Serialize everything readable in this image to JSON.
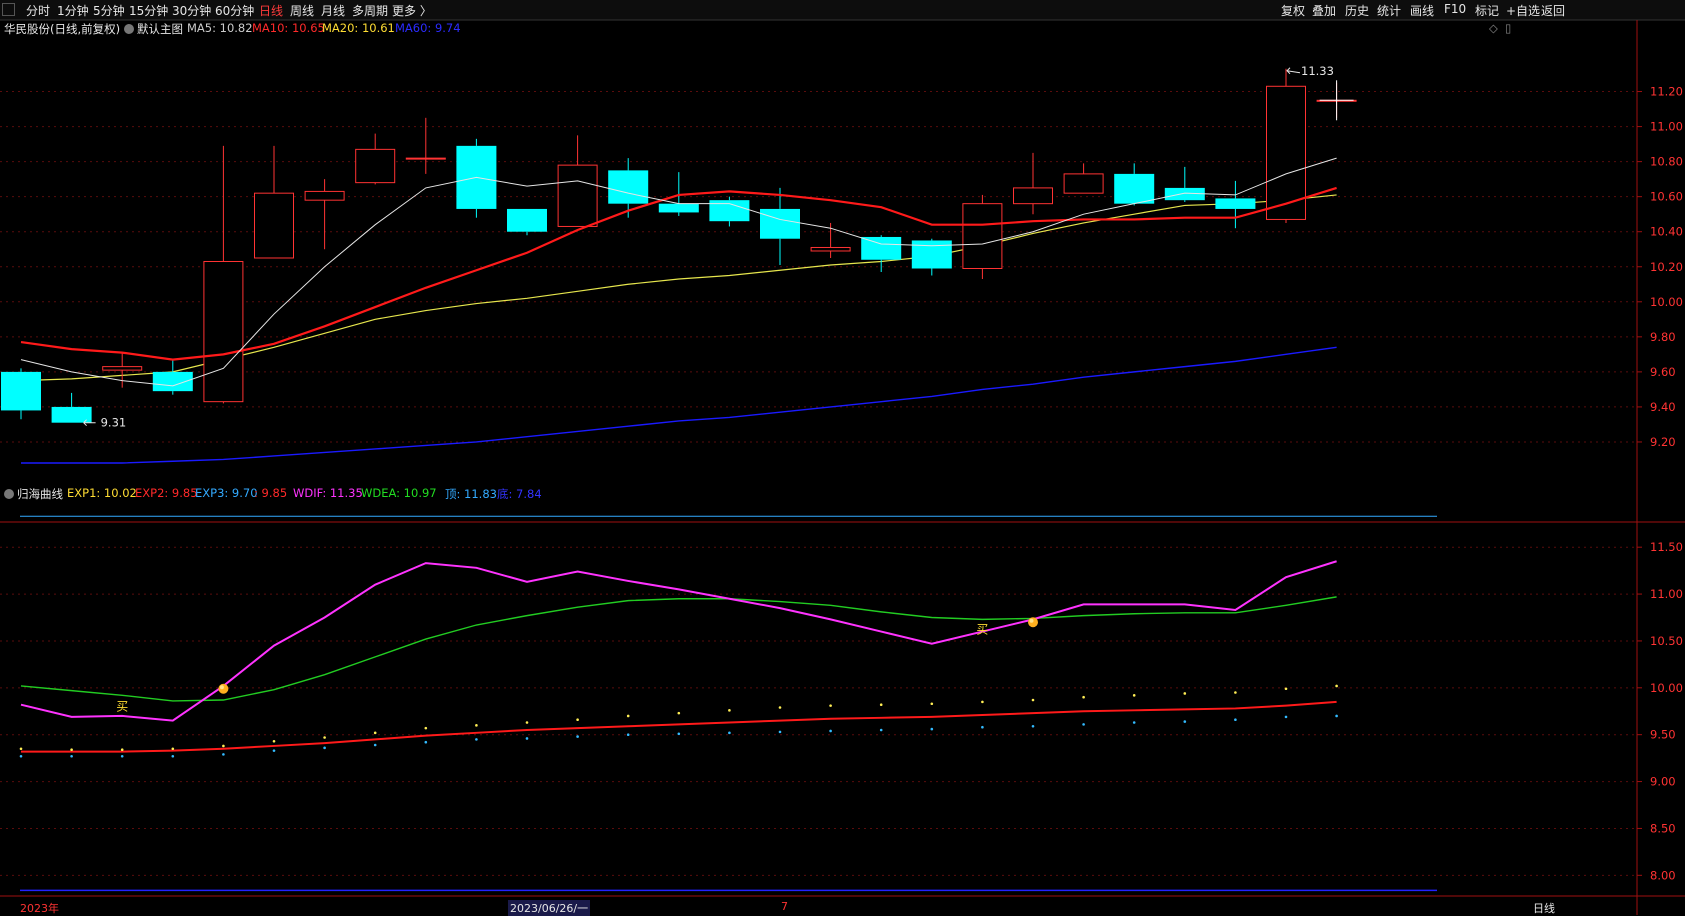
{
  "topbar": {
    "left_items": [
      "分时",
      "1分钟",
      "5分钟",
      "15分钟",
      "30分钟",
      "60分钟",
      "日线",
      "周线",
      "月线",
      "多周期",
      "更多 〉"
    ],
    "active_item": "日线",
    "right_items": [
      "复权",
      "叠加",
      "历史",
      "统计",
      "画线",
      "F10",
      "标记",
      "+自选",
      "返回"
    ]
  },
  "main_panel": {
    "stock_title": "华民股份(日线,前复权)",
    "template_name": "默认主图",
    "ma": [
      {
        "label": "MA5: 10.82",
        "color": "#e6e6e6"
      },
      {
        "label": "MA10: 10.65",
        "color": "#ff2a2a"
      },
      {
        "label": "MA20: 10.61",
        "color": "#ffdd33"
      },
      {
        "label": "MA60: 9.74",
        "color": "#2b2bff"
      }
    ],
    "yaxis": [
      "11.20",
      "11.00",
      "10.80",
      "10.60",
      "10.40",
      "10.20",
      "10.00",
      "9.80",
      "9.60",
      "9.40",
      "9.20"
    ],
    "high_mark": "11.33",
    "low_mark": "9.31"
  },
  "sub_panel": {
    "indicator_name": "归海曲线",
    "values": [
      {
        "label": "EXP1: 10.02",
        "color": "#ffdd33"
      },
      {
        "label": "EXP2: 9.85",
        "color": "#ff2a2a"
      },
      {
        "label": "EXP3: 9.70",
        "color": "#33aaff"
      },
      {
        "label": ": 9.85",
        "color": "#ff2a2a"
      },
      {
        "label": "WDIF: 11.35",
        "color": "#ff33ff"
      },
      {
        "label": "WDEA: 10.97",
        "color": "#22dd22"
      },
      {
        "label": "顶: 11.83",
        "color": "#33aaff"
      },
      {
        "label": "底: 7.84",
        "color": "#3333ff"
      }
    ],
    "yaxis": [
      "11.50",
      "11.00",
      "10.50",
      "10.00",
      "9.50",
      "9.00",
      "8.50",
      "8.00"
    ],
    "buy_label": "买"
  },
  "bottom": {
    "year": "2023年",
    "date_cursor": "2023/06/26/一",
    "month": "7",
    "period": "日线"
  },
  "colors": {
    "up": "#ff3333",
    "down": "#00ffff",
    "ma5": "#e6e6e6",
    "ma10": "#ff1a1a",
    "ma20": "#e6e64d",
    "ma60": "#1a1aff",
    "wdif": "#ff33ff",
    "wdea": "#22cc22",
    "axis": "#a01010"
  },
  "chart_data": {
    "type": "candlestick",
    "candles": [
      {
        "o": 9.6,
        "c": 9.38,
        "h": 9.62,
        "l": 9.33
      },
      {
        "o": 9.4,
        "c": 9.31,
        "h": 9.48,
        "l": 9.31
      },
      {
        "o": 9.61,
        "c": 9.63,
        "h": 9.71,
        "l": 9.51
      },
      {
        "o": 9.6,
        "c": 9.49,
        "h": 9.67,
        "l": 9.47
      },
      {
        "o": 9.43,
        "c": 10.23,
        "h": 10.89,
        "l": 9.42
      },
      {
        "o": 10.25,
        "c": 10.62,
        "h": 10.89,
        "l": 10.25
      },
      {
        "o": 10.58,
        "c": 10.63,
        "h": 10.7,
        "l": 10.3
      },
      {
        "o": 10.68,
        "c": 10.87,
        "h": 10.96,
        "l": 10.67
      },
      {
        "o": 10.82,
        "c": 10.82,
        "h": 11.05,
        "l": 10.73
      },
      {
        "o": 10.89,
        "c": 10.53,
        "h": 10.93,
        "l": 10.48
      },
      {
        "o": 10.53,
        "c": 10.4,
        "h": 10.53,
        "l": 10.38
      },
      {
        "o": 10.43,
        "c": 10.78,
        "h": 10.95,
        "l": 10.43
      },
      {
        "o": 10.75,
        "c": 10.56,
        "h": 10.82,
        "l": 10.48
      },
      {
        "o": 10.56,
        "c": 10.51,
        "h": 10.74,
        "l": 10.49
      },
      {
        "o": 10.58,
        "c": 10.46,
        "h": 10.6,
        "l": 10.43
      },
      {
        "o": 10.53,
        "c": 10.36,
        "h": 10.65,
        "l": 10.21
      },
      {
        "o": 10.29,
        "c": 10.31,
        "h": 10.45,
        "l": 10.25
      },
      {
        "o": 10.37,
        "c": 10.24,
        "h": 10.38,
        "l": 10.17
      },
      {
        "o": 10.35,
        "c": 10.19,
        "h": 10.36,
        "l": 10.15
      },
      {
        "o": 10.19,
        "c": 10.56,
        "h": 10.61,
        "l": 10.13
      },
      {
        "o": 10.56,
        "c": 10.65,
        "h": 10.85,
        "l": 10.5
      },
      {
        "o": 10.62,
        "c": 10.73,
        "h": 10.79,
        "l": 10.62
      },
      {
        "o": 10.73,
        "c": 10.56,
        "h": 10.79,
        "l": 10.55
      },
      {
        "o": 10.65,
        "c": 10.58,
        "h": 10.77,
        "l": 10.57
      },
      {
        "o": 10.59,
        "c": 10.53,
        "h": 10.69,
        "l": 10.42
      },
      {
        "o": 10.47,
        "c": 11.23,
        "h": 11.33,
        "l": 10.45
      },
      {
        "o": 11.15,
        "c": 11.15,
        "h": 11.25,
        "l": 11.05
      }
    ],
    "ma5": [
      9.67,
      9.6,
      9.55,
      9.52,
      9.62,
      9.93,
      10.2,
      10.44,
      10.65,
      10.71,
      10.66,
      10.69,
      10.62,
      10.56,
      10.56,
      10.47,
      10.42,
      10.33,
      10.32,
      10.33,
      10.4,
      10.5,
      10.56,
      10.62,
      10.61,
      10.73,
      10.82
    ],
    "ma10": [
      9.77,
      9.73,
      9.71,
      9.67,
      9.7,
      9.76,
      9.86,
      9.97,
      10.08,
      10.18,
      10.28,
      10.41,
      10.52,
      10.61,
      10.63,
      10.61,
      10.58,
      10.54,
      10.44,
      10.44,
      10.46,
      10.47,
      10.47,
      10.48,
      10.48,
      10.56,
      10.65
    ],
    "ma20": [
      9.55,
      9.56,
      9.58,
      9.6,
      9.67,
      9.74,
      9.82,
      9.9,
      9.95,
      9.99,
      10.02,
      10.06,
      10.1,
      10.13,
      10.15,
      10.18,
      10.21,
      10.23,
      10.26,
      10.32,
      10.39,
      10.45,
      10.5,
      10.55,
      10.56,
      10.58,
      10.61
    ],
    "ma60": [
      9.08,
      9.08,
      9.08,
      9.09,
      9.1,
      9.12,
      9.14,
      9.16,
      9.18,
      9.2,
      9.23,
      9.26,
      9.29,
      9.32,
      9.34,
      9.37,
      9.4,
      9.43,
      9.46,
      9.5,
      9.53,
      9.57,
      9.6,
      9.63,
      9.66,
      9.7,
      9.74
    ],
    "wdif": [
      9.82,
      9.69,
      9.7,
      9.65,
      10.02,
      10.45,
      10.75,
      11.1,
      11.33,
      11.28,
      11.13,
      11.24,
      11.14,
      11.05,
      10.95,
      10.85,
      10.73,
      10.6,
      10.47,
      10.6,
      10.73,
      10.89,
      10.89,
      10.89,
      10.83,
      11.18,
      11.35
    ],
    "wdea": [
      10.02,
      9.97,
      9.92,
      9.86,
      9.87,
      9.98,
      10.14,
      10.33,
      10.52,
      10.67,
      10.77,
      10.86,
      10.93,
      10.95,
      10.95,
      10.92,
      10.88,
      10.81,
      10.75,
      10.73,
      10.74,
      10.77,
      10.79,
      10.8,
      10.8,
      10.88,
      10.97
    ],
    "exp2": [
      9.32,
      9.32,
      9.32,
      9.33,
      9.35,
      9.38,
      9.41,
      9.45,
      9.49,
      9.52,
      9.55,
      9.57,
      9.59,
      9.61,
      9.63,
      9.65,
      9.67,
      9.68,
      9.69,
      9.71,
      9.73,
      9.75,
      9.76,
      9.77,
      9.78,
      9.81,
      9.85
    ],
    "exp1": [
      9.35,
      9.34,
      9.34,
      9.35,
      9.38,
      9.43,
      9.47,
      9.52,
      9.57,
      9.6,
      9.63,
      9.66,
      9.7,
      9.73,
      9.76,
      9.79,
      9.81,
      9.82,
      9.83,
      9.85,
      9.87,
      9.9,
      9.92,
      9.94,
      9.95,
      9.99,
      10.02
    ],
    "exp3": [
      9.27,
      9.27,
      9.27,
      9.27,
      9.29,
      9.33,
      9.36,
      9.39,
      9.42,
      9.45,
      9.46,
      9.48,
      9.5,
      9.51,
      9.52,
      9.53,
      9.54,
      9.55,
      9.56,
      9.58,
      9.59,
      9.61,
      9.63,
      9.64,
      9.66,
      9.69,
      9.7
    ],
    "top": 11.83,
    "bottom": 7.84,
    "buy_signals": [
      {
        "index": 2,
        "price": 9.8
      },
      {
        "index": 19,
        "price": 10.62
      }
    ],
    "gold_markers": [
      {
        "index": 4,
        "price": 9.99
      },
      {
        "index": 20,
        "price": 10.7
      }
    ],
    "main_ylim": [
      9.04,
      11.38
    ],
    "sub_ylim": [
      7.79,
      11.95
    ]
  }
}
